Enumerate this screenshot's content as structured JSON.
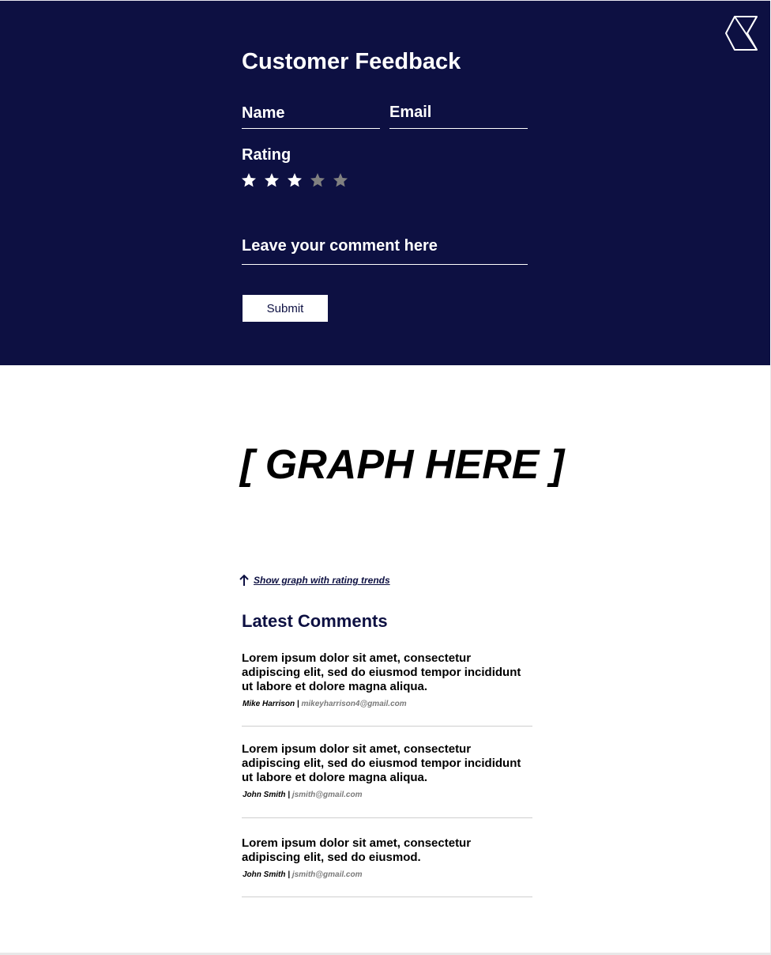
{
  "form": {
    "title": "Customer Feedback",
    "name_placeholder": "Name",
    "email_placeholder": "Email",
    "rating_label": "Rating",
    "rating_value": 3,
    "rating_max": 5,
    "comment_placeholder": "Leave your comment here",
    "submit_label": "Submit"
  },
  "graph": {
    "placeholder": "[ GRAPH HERE ]",
    "toggle_label": "Show graph with rating trends"
  },
  "comments": {
    "title": "Latest Comments",
    "items": [
      {
        "text": "Lorem ipsum dolor sit amet, consectetur adipiscing elit, sed do eiusmod tempor incididunt ut labore et dolore magna aliqua.",
        "author": "Mike Harrison",
        "email": "mikeyharrison4@gmail.com"
      },
      {
        "text": "Lorem ipsum dolor sit amet, consectetur adipiscing elit, sed do eiusmod tempor incididunt ut labore et dolore magna aliqua.",
        "author": "John Smith",
        "email": "jsmith@gmail.com"
      },
      {
        "text": "Lorem ipsum dolor sit amet, consectetur adipiscing elit, sed do eiusmod.",
        "author": "John Smith",
        "email": "jsmith@gmail.com"
      }
    ],
    "separator": "|"
  },
  "icons": {
    "logo": "hexagon-x-logo-icon",
    "star": "star-icon",
    "arrow": "arrow-up-icon"
  },
  "colors": {
    "navy": "#0d1042",
    "star_filled": "#ffffff",
    "star_empty": "#808080",
    "email_gray": "#7a7a7a"
  }
}
